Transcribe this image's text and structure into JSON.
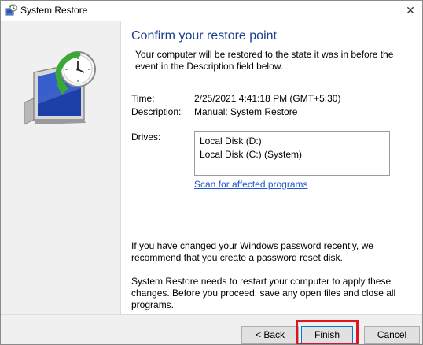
{
  "window": {
    "title": "System Restore",
    "close_glyph": "✕"
  },
  "content": {
    "heading": "Confirm your restore point",
    "intro": "Your computer will be restored to the state it was in before the event in the Description field below.",
    "time_label": "Time:",
    "time_value": "2/25/2021 4:41:18 PM (GMT+5:30)",
    "description_label": "Description:",
    "description_value": "Manual: System Restore",
    "drives_label": "Drives:",
    "drives": [
      "Local Disk (D:)",
      "Local Disk (C:) (System)"
    ],
    "scan_link": "Scan for affected programs",
    "password_note": "If you have changed your Windows password recently, we recommend that you create a password reset disk.",
    "restart_note": "System Restore needs to restart your computer to apply these changes. Before you proceed, save any open files and close all programs."
  },
  "footer": {
    "back_label": "< Back",
    "finish_label": "Finish",
    "cancel_label": "Cancel"
  },
  "colors": {
    "heading": "#1a3e8c",
    "link": "#1f56d1",
    "highlight": "#e0141e",
    "panel": "#f0f0f0"
  },
  "icons": {
    "title": "system-restore-icon",
    "hero": "system-restore-clock-monitor-icon",
    "close": "close-icon"
  }
}
